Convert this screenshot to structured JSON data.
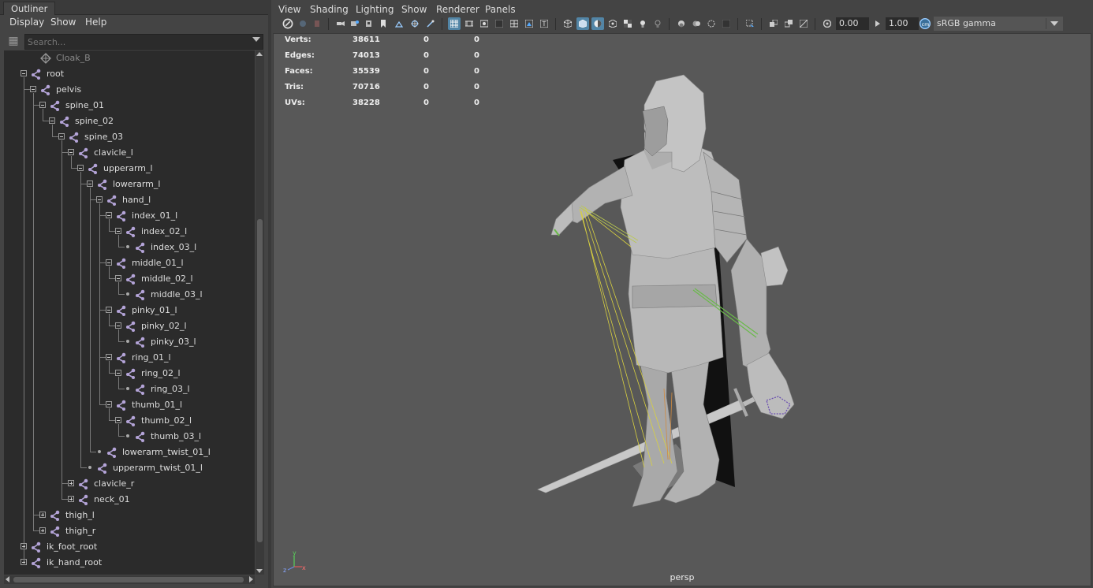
{
  "outliner": {
    "tab_label": "Outliner",
    "menu": [
      "Display",
      "Show",
      "Help"
    ],
    "search_placeholder": "Search...",
    "items": [
      {
        "label": "Cloak_B",
        "dim": true
      },
      {
        "label": "root"
      },
      {
        "label": "pelvis"
      },
      {
        "label": "spine_01"
      },
      {
        "label": "spine_02"
      },
      {
        "label": "spine_03"
      },
      {
        "label": "clavicle_l"
      },
      {
        "label": "upperarm_l"
      },
      {
        "label": "lowerarm_l"
      },
      {
        "label": "hand_l"
      },
      {
        "label": "index_01_l"
      },
      {
        "label": "index_02_l"
      },
      {
        "label": "index_03_l"
      },
      {
        "label": "middle_01_l"
      },
      {
        "label": "middle_02_l"
      },
      {
        "label": "middle_03_l"
      },
      {
        "label": "pinky_01_l"
      },
      {
        "label": "pinky_02_l"
      },
      {
        "label": "pinky_03_l"
      },
      {
        "label": "ring_01_l"
      },
      {
        "label": "ring_02_l"
      },
      {
        "label": "ring_03_l"
      },
      {
        "label": "thumb_01_l"
      },
      {
        "label": "thumb_02_l"
      },
      {
        "label": "thumb_03_l"
      },
      {
        "label": "lowerarm_twist_01_l"
      },
      {
        "label": "upperarm_twist_01_l"
      },
      {
        "label": "clavicle_r"
      },
      {
        "label": "neck_01"
      },
      {
        "label": "thigh_l"
      },
      {
        "label": "thigh_r"
      },
      {
        "label": "ik_foot_root"
      },
      {
        "label": "ik_hand_root"
      }
    ]
  },
  "viewport": {
    "menu": [
      "View",
      "Shading",
      "Lighting",
      "Show",
      "Renderer",
      "Panels"
    ],
    "exposure": "0.00",
    "gamma": "1.00",
    "color_space": "sRGB gamma",
    "camera": "persp",
    "hud": [
      {
        "label": "Verts:",
        "v1": "38611",
        "v2": "0",
        "v3": "0"
      },
      {
        "label": "Edges:",
        "v1": "74013",
        "v2": "0",
        "v3": "0"
      },
      {
        "label": "Faces:",
        "v1": "35539",
        "v2": "0",
        "v3": "0"
      },
      {
        "label": "Tris:",
        "v1": "70716",
        "v2": "0",
        "v3": "0"
      },
      {
        "label": "UVs:",
        "v1": "38228",
        "v2": "0",
        "v3": "0"
      }
    ],
    "axis_labels": {
      "y": "y",
      "z": "z",
      "x": "x"
    }
  },
  "colors": {
    "accent": "#5285a6",
    "joint_icon": "#b4a4d8",
    "joint_lines": "#d8d040",
    "ik_line": "#6ab94a"
  }
}
